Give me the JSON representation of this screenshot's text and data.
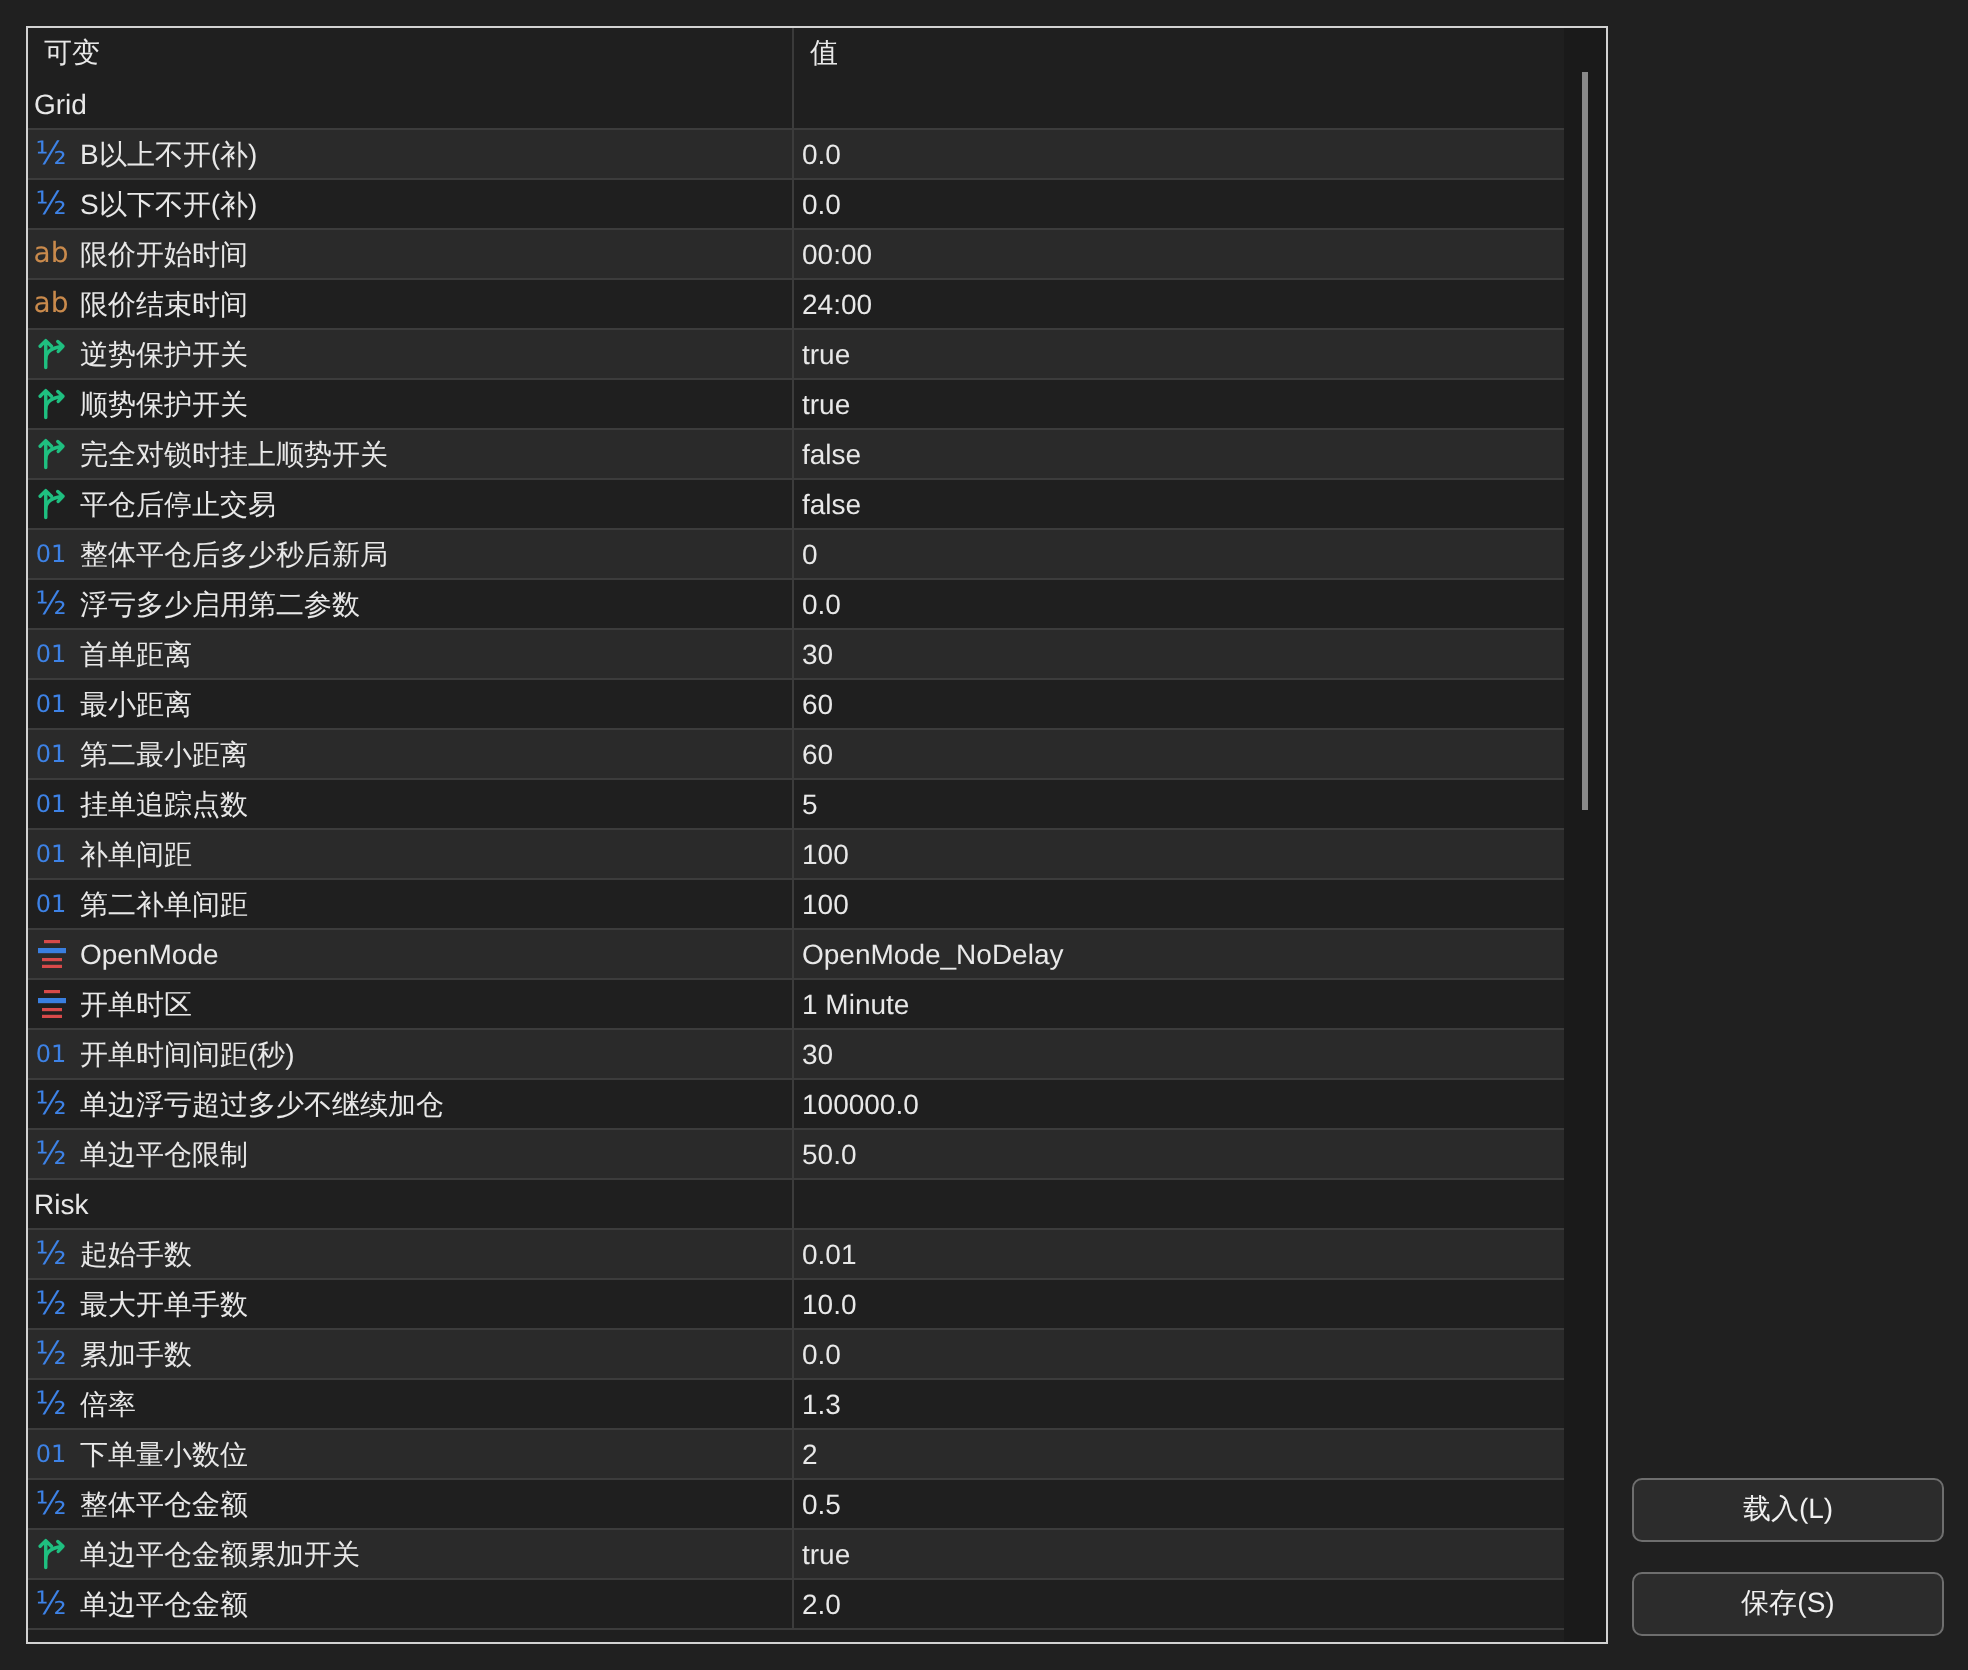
{
  "table": {
    "columns": [
      "可变",
      "值"
    ],
    "groups": [
      {
        "name": "Grid",
        "rows": [
          {
            "kind": "double",
            "icon": "½",
            "name": "B以上不开(补)",
            "value": "0.0"
          },
          {
            "kind": "double",
            "icon": "½",
            "name": "S以下不开(补)",
            "value": "0.0"
          },
          {
            "kind": "string",
            "icon": "ab",
            "name": "限价开始时间",
            "value": "00:00"
          },
          {
            "kind": "string",
            "icon": "ab",
            "name": "限价结束时间",
            "value": "24:00"
          },
          {
            "kind": "bool",
            "name": "逆势保护开关",
            "value": "true"
          },
          {
            "kind": "bool",
            "name": "顺势保护开关",
            "value": "true"
          },
          {
            "kind": "bool",
            "name": "完全对锁时挂上顺势开关",
            "value": "false"
          },
          {
            "kind": "bool",
            "name": "平仓后停止交易",
            "value": "false"
          },
          {
            "kind": "int",
            "icon": "01",
            "name": "整体平仓后多少秒后新局",
            "value": "0"
          },
          {
            "kind": "double",
            "icon": "½",
            "name": "浮亏多少启用第二参数",
            "value": "0.0"
          },
          {
            "kind": "int",
            "icon": "01",
            "name": "首单距离",
            "value": "30"
          },
          {
            "kind": "int",
            "icon": "01",
            "name": "最小距离",
            "value": "60"
          },
          {
            "kind": "int",
            "icon": "01",
            "name": "第二最小距离",
            "value": "60"
          },
          {
            "kind": "int",
            "icon": "01",
            "name": "挂单追踪点数",
            "value": "5"
          },
          {
            "kind": "int",
            "icon": "01",
            "name": "补单间距",
            "value": "100"
          },
          {
            "kind": "int",
            "icon": "01",
            "name": "第二补单间距",
            "value": "100"
          },
          {
            "kind": "enum",
            "name": "OpenMode",
            "value": "OpenMode_NoDelay"
          },
          {
            "kind": "enum",
            "name": "开单时区",
            "value": "1 Minute"
          },
          {
            "kind": "int",
            "icon": "01",
            "name": "开单时间间距(秒)",
            "value": "30"
          },
          {
            "kind": "double",
            "icon": "½",
            "name": "单边浮亏超过多少不继续加仓",
            "value": "100000.0"
          },
          {
            "kind": "double",
            "icon": "½",
            "name": "单边平仓限制",
            "value": "50.0"
          }
        ]
      },
      {
        "name": "Risk",
        "rows": [
          {
            "kind": "double",
            "icon": "½",
            "name": "起始手数",
            "value": "0.01"
          },
          {
            "kind": "double",
            "icon": "½",
            "name": "最大开单手数",
            "value": "10.0"
          },
          {
            "kind": "double",
            "icon": "½",
            "name": "累加手数",
            "value": "0.0"
          },
          {
            "kind": "double",
            "icon": "½",
            "name": "倍率",
            "value": "1.3"
          },
          {
            "kind": "int",
            "icon": "01",
            "name": "下单量小数位",
            "value": "2"
          },
          {
            "kind": "double",
            "icon": "½",
            "name": "整体平仓金额",
            "value": "0.5"
          },
          {
            "kind": "bool",
            "name": "单边平仓金额累加开关",
            "value": "true"
          },
          {
            "kind": "double",
            "icon": "½",
            "name": "单边平仓金额",
            "value": "2.0"
          }
        ]
      }
    ]
  },
  "buttons": [
    "载入(L)",
    "保存(S)"
  ]
}
